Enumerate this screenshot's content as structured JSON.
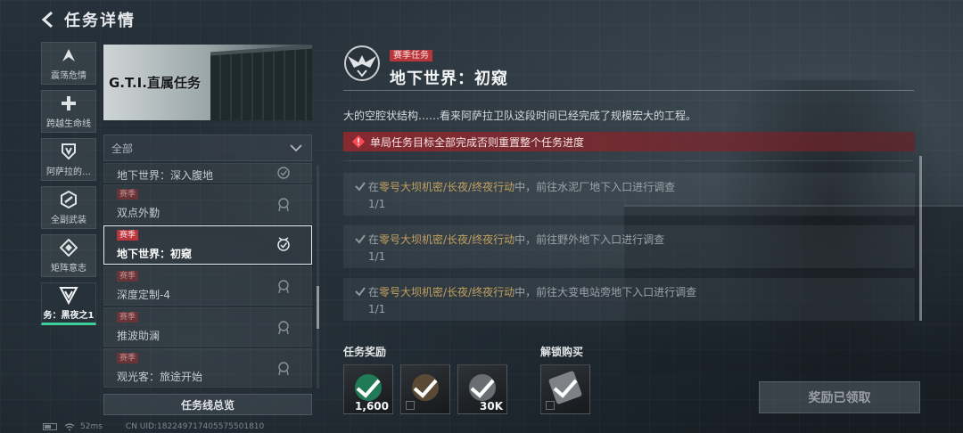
{
  "header": {
    "title": "任务详情"
  },
  "nav": [
    {
      "label": "震荡危情",
      "icon": "chevron-a-icon"
    },
    {
      "label": "跨越生命线",
      "icon": "cross-plus-icon"
    },
    {
      "label": "阿萨拉的…",
      "icon": "shield-v-icon"
    },
    {
      "label": "全副武装",
      "icon": "hexagon-slash-icon"
    },
    {
      "label": "矩阵意志",
      "icon": "diamond-target-icon"
    },
    {
      "label": "务：黑夜之1",
      "icon": "triangle-v-icon"
    }
  ],
  "banner": {
    "title": "G.T.I.直属任务"
  },
  "filter": {
    "label": "全部"
  },
  "tasks": [
    {
      "tag": "",
      "name": "地下世界：深入腹地"
    },
    {
      "tag": "赛季",
      "name": "双点外勤"
    },
    {
      "tag": "赛季",
      "name": "地下世界：初窥"
    },
    {
      "tag": "赛季",
      "name": "深度定制-4"
    },
    {
      "tag": "赛季",
      "name": "推波助澜"
    },
    {
      "tag": "赛季",
      "name": "观光客：旅途开始"
    }
  ],
  "overview_button": "任务线总览",
  "detail": {
    "tag": "赛季任务",
    "title": "地下世界：初窥",
    "description": "大的空腔状结构……看来阿萨拉卫队这段时间已经完成了规模宏大的工程。",
    "warning": "单局任务目标全部完成否则重置整个任务进度",
    "objectives": [
      {
        "prefix": "在",
        "highlight": "零号大坝机密/长夜/终夜行动",
        "suffix": "中，前往水泥厂地下入口进行调查",
        "progress": "1/1"
      },
      {
        "prefix": "在",
        "highlight": "零号大坝机密/长夜/终夜行动",
        "suffix": "中，前往野外地下入口进行调查",
        "progress": "1/1"
      },
      {
        "prefix": "在",
        "highlight": "零号大坝机密/长夜/终夜行动",
        "suffix": "中，前往大变电站旁地下入口进行调查",
        "progress": "1/1"
      }
    ]
  },
  "rewards_label": "任务奖励",
  "rewards": [
    {
      "qty": "1,600",
      "icon": "green-currency-icon"
    },
    {
      "qty": "",
      "icon": "grenade-icon"
    },
    {
      "qty": "30K",
      "icon": "coin-icon"
    }
  ],
  "unlock_label": "解锁购买",
  "unlock": [
    {
      "qty": "",
      "icon": "card-item-icon"
    }
  ],
  "claimed_button": "奖励已领取",
  "status": {
    "ping": "52ms",
    "uid": "CN UID:182249717405575501810"
  },
  "colors": {
    "accent": "#3ccf9a",
    "tag_red": "#b8353b",
    "highlight": "#c2a15f"
  }
}
